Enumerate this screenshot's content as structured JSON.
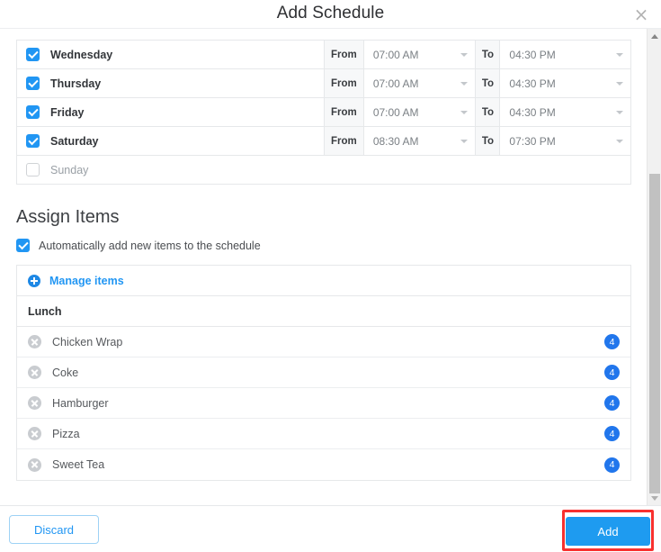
{
  "header": {
    "title": "Add Schedule",
    "close_label": "×"
  },
  "schedule": {
    "from_label": "From",
    "to_label": "To",
    "rows": [
      {
        "day": "Wednesday",
        "checked": true,
        "from": "07:00 AM",
        "to": "04:30 PM"
      },
      {
        "day": "Thursday",
        "checked": true,
        "from": "07:00 AM",
        "to": "04:30 PM"
      },
      {
        "day": "Friday",
        "checked": true,
        "from": "07:00 AM",
        "to": "04:30 PM"
      },
      {
        "day": "Saturday",
        "checked": true,
        "from": "08:30 AM",
        "to": "07:30 PM"
      },
      {
        "day": "Sunday",
        "checked": false,
        "from": "",
        "to": ""
      }
    ]
  },
  "assign_items": {
    "section_title": "Assign Items",
    "auto_add_label": "Automatically add new items to the schedule",
    "auto_add_checked": true,
    "manage_items_label": "Manage items",
    "group_label": "Lunch",
    "items": [
      {
        "name": "Chicken Wrap",
        "qty": "4"
      },
      {
        "name": "Coke",
        "qty": "4"
      },
      {
        "name": "Hamburger",
        "qty": "4"
      },
      {
        "name": "Pizza",
        "qty": "4"
      },
      {
        "name": "Sweet Tea",
        "qty": "4"
      }
    ]
  },
  "footer": {
    "discard_label": "Discard",
    "add_label": "Add"
  },
  "colors": {
    "accent_blue": "#2196f3",
    "button_blue": "#1e9bf0",
    "badge_blue": "#2176ec",
    "highlight_red": "#f8312f",
    "border_gray": "#e6e8ea"
  }
}
